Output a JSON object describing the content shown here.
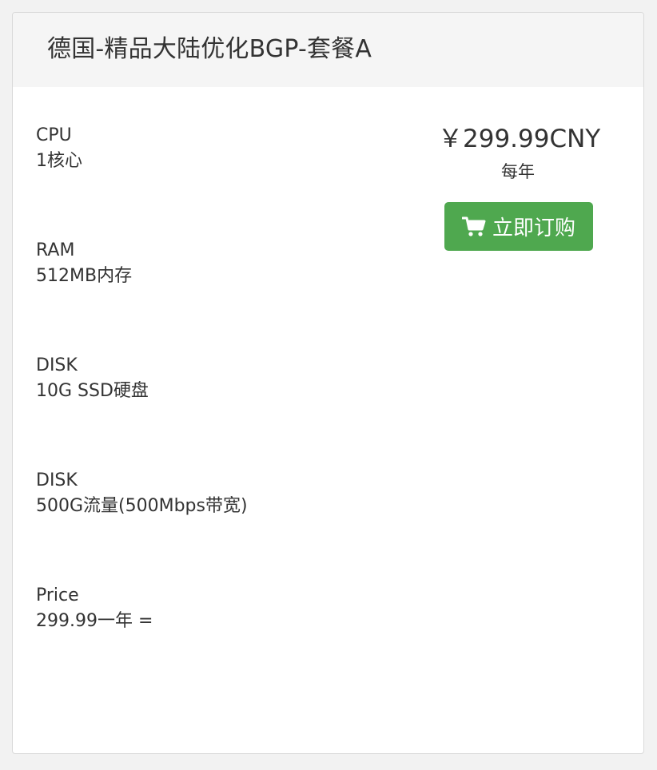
{
  "product": {
    "title": "德国-精品大陆优化BGP-套餐A"
  },
  "specs": [
    {
      "label": "CPU",
      "value": "1核心"
    },
    {
      "label": "RAM",
      "value": "512MB内存"
    },
    {
      "label": "DISK",
      "value": "10G SSD硬盘"
    },
    {
      "label": "DISK",
      "value": "500G流量(500Mbps带宽)"
    },
    {
      "label": "Price",
      "value": "299.99一年 ="
    }
  ],
  "pricing": {
    "price": "￥299.99CNY",
    "period": "每年"
  },
  "order_button": {
    "label": "立即订购",
    "icon": "shopping-cart-icon"
  },
  "colors": {
    "button": "#4fa84f",
    "header_bg": "#f5f5f5"
  }
}
